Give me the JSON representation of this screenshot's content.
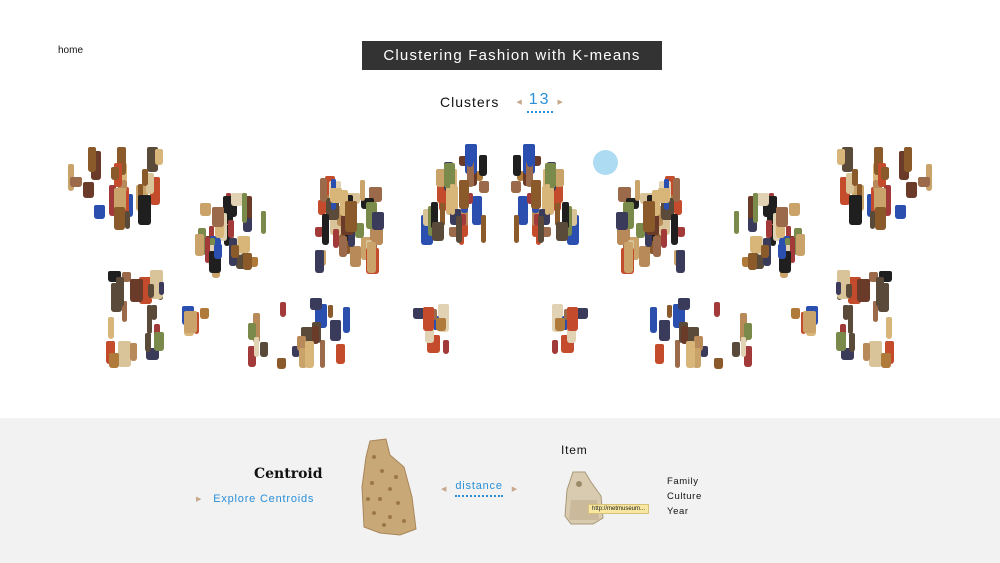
{
  "nav": {
    "home_label": "home"
  },
  "header": {
    "title": "Clustering Fashion with K-means"
  },
  "clusters": {
    "label": "Clusters",
    "value": "13",
    "prev_icon": "triangle-left-icon",
    "next_icon": "triangle-right-icon"
  },
  "colors": {
    "accent": "#2a8fd8",
    "title_bg": "#333333",
    "panel_bg": "#f2f2f2",
    "highlight": "#9fd5ee",
    "url_bg": "#f7e7a0"
  },
  "bottom": {
    "centroid_title": "Centroid",
    "explore_label": "Explore Centroids",
    "distance_label": "distance",
    "item_title": "Item",
    "item_url": "http://metmuseum...",
    "item_fields": {
      "family": "Family",
      "culture": "Culture",
      "year": "Year"
    }
  }
}
